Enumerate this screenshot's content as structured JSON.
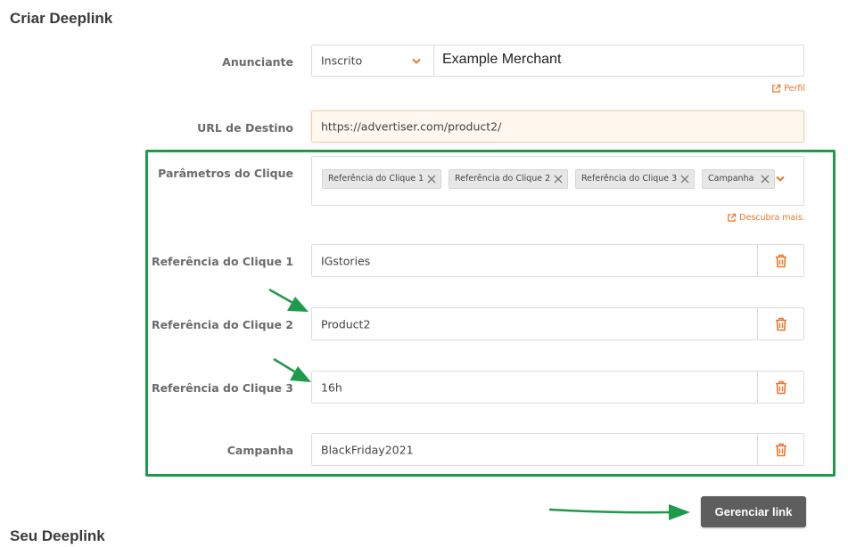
{
  "header": {
    "title": "Criar Deeplink"
  },
  "advertiser": {
    "label": "Anunciante",
    "select_value": "Inscrito",
    "name_value": "Example Merchant",
    "profile_link": "Perfil"
  },
  "destination": {
    "label": "URL de Destino",
    "value": "https://advertiser.com/product2/"
  },
  "click_params": {
    "label": "Parâmetros do Clique",
    "chips": [
      "Referência do Clique 1",
      "Referência do Clique 2",
      "Referência do Clique 3",
      "Campanha"
    ],
    "learn_more": "Descubra mais."
  },
  "params": [
    {
      "label": "Referência do Clique 1",
      "value": "IGstories"
    },
    {
      "label": "Referência do Clique 2",
      "value": "Product2"
    },
    {
      "label": "Referência do Clique 3",
      "value": "16h"
    },
    {
      "label": "Campanha",
      "value": "BlackFriday2021"
    }
  ],
  "actions": {
    "manage_link": "Gerenciar link"
  },
  "footer": {
    "title": "Seu Deeplink"
  },
  "icons": {
    "dropdown": "chevron-down-icon",
    "external": "external-link-icon",
    "remove": "close-icon",
    "delete": "trash-icon",
    "annotation": "arrow-icon"
  },
  "colors": {
    "accent": "#e8772e",
    "highlight": "#1e9a4b",
    "button_bg": "#5e5e5e",
    "url_field_bg": "#fff8ef"
  }
}
